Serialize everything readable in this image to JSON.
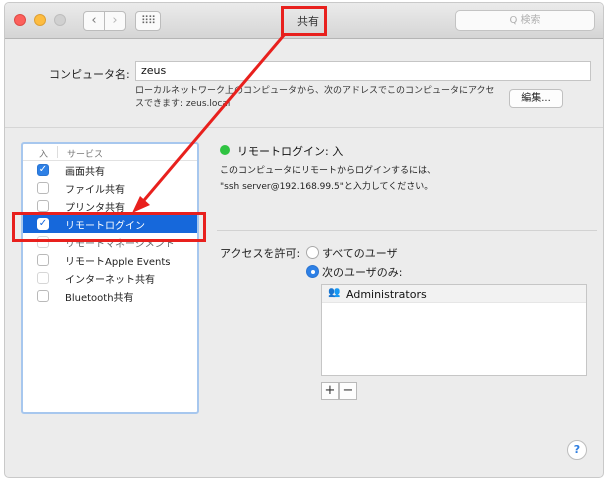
{
  "window": {
    "title": "共有",
    "search_placeholder": "Q 検索",
    "nav_back": "‹",
    "nav_forward": "›",
    "grid_icon": "⠿⠿"
  },
  "computer_name": {
    "label": "コンピュータ名:",
    "value": "zeus",
    "description": "ローカルネットワーク上のコンピュータから、次のアドレスでこのコンピュータにアクセスできます: zeus.local",
    "edit_button": "編集..."
  },
  "services": {
    "header_on": "入",
    "header_service": "サービス",
    "items": [
      {
        "label": "画面共有",
        "checked": true
      },
      {
        "label": "ファイル共有",
        "checked": false
      },
      {
        "label": "プリンタ共有",
        "checked": false
      },
      {
        "label": "リモートログイン",
        "checked": true,
        "selected": true
      },
      {
        "label": "リモートマネージメント",
        "checked": false
      },
      {
        "label": "リモートApple Events",
        "checked": false
      },
      {
        "label": "インターネット共有",
        "checked": false
      },
      {
        "label": "Bluetooth共有",
        "checked": false
      }
    ]
  },
  "detail": {
    "status": "リモートログイン: 入",
    "status_color": "#2fc341",
    "desc_line1": "このコンピュータにリモートからログインするには、",
    "desc_line2": "\"ssh server@192.168.99.5\"と入力してください。",
    "access_label": "アクセスを許可:",
    "option_all": "すべてのユーザ",
    "option_only": "次のユーザのみ:",
    "selected_option": "only",
    "users": [
      {
        "name": "Administrators",
        "icon": "group-icon"
      }
    ],
    "add_label": "+",
    "remove_label": "−",
    "help_label": "?"
  },
  "colors": {
    "annotation": "#e8201d",
    "selection": "#1668db",
    "checkbox_on": "#2d80e6"
  }
}
